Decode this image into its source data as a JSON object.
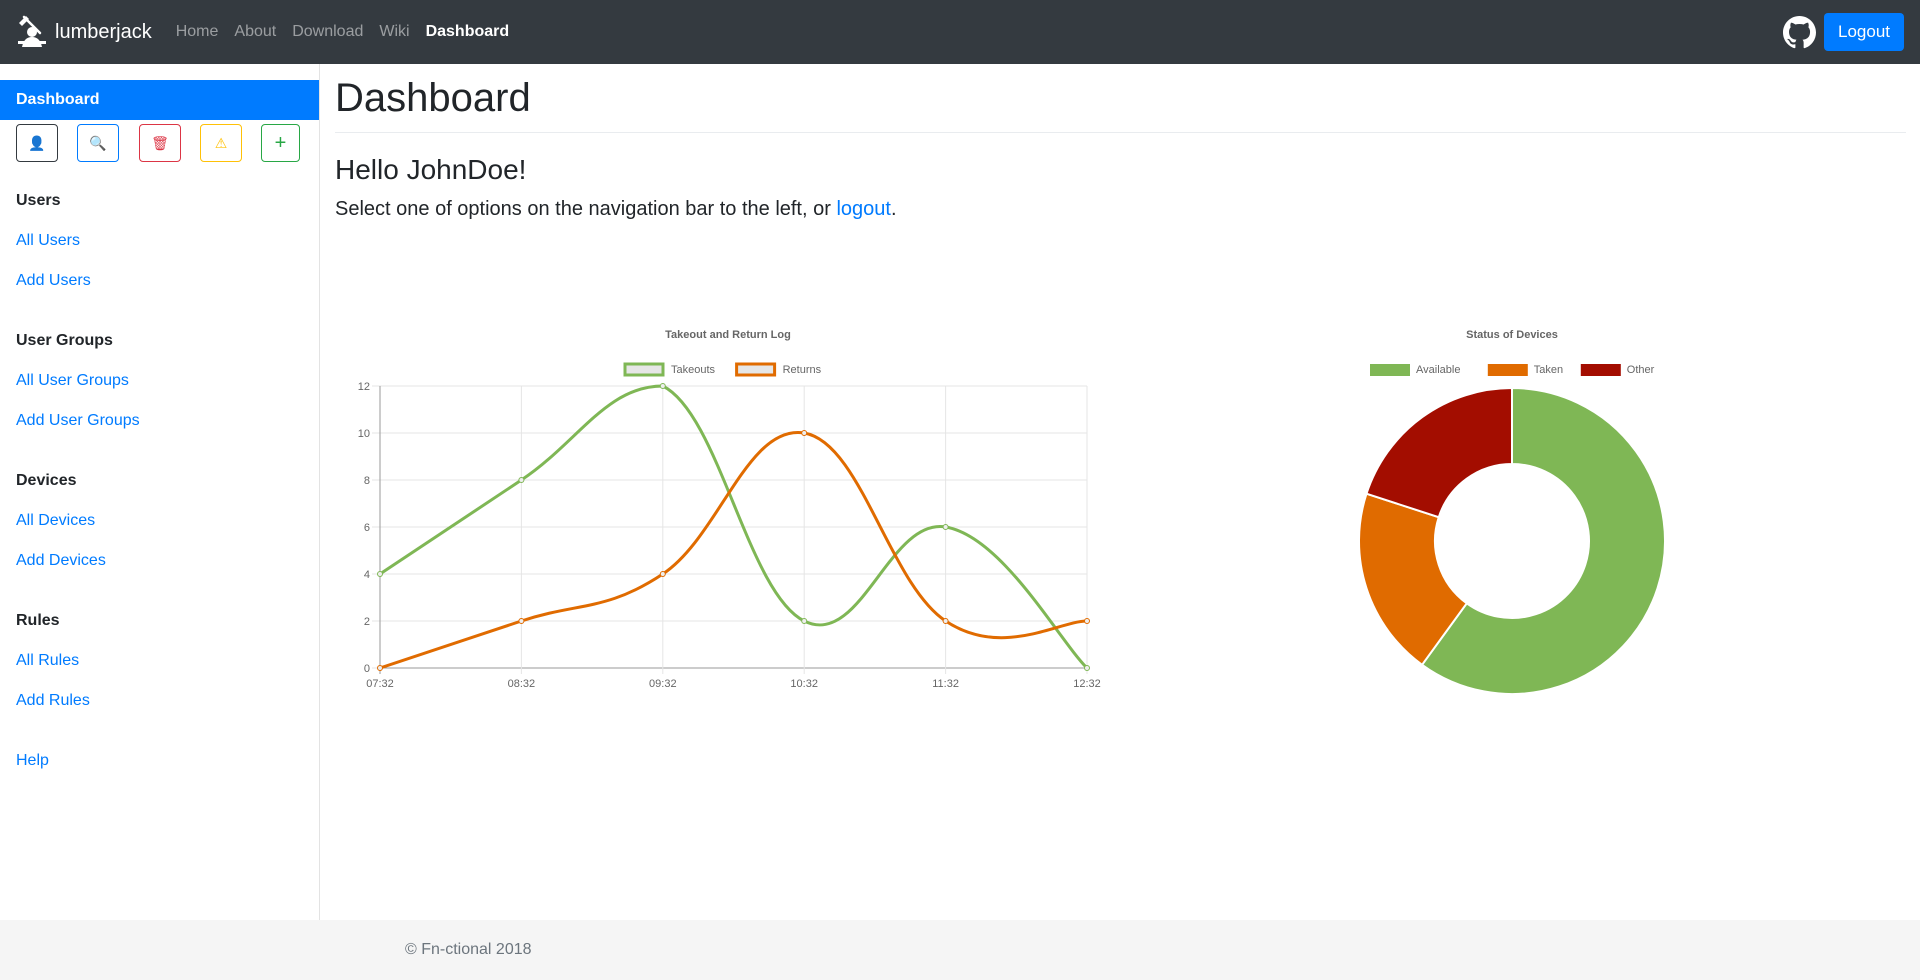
{
  "navbar": {
    "brand": "lumberjack",
    "links": [
      "Home",
      "About",
      "Download",
      "Wiki",
      "Dashboard"
    ],
    "active_link": "Dashboard",
    "logout": "Logout",
    "github_icon": "github-icon",
    "brand_icon": "lumberjack-logo-icon"
  },
  "sidebar": {
    "active_item": "Dashboard",
    "quick_actions": [
      {
        "icon": "user-icon",
        "glyph": "👤",
        "color": "#343a40"
      },
      {
        "icon": "search-icon",
        "glyph": "🔍",
        "color": "#007bff"
      },
      {
        "icon": "trash-icon",
        "glyph": "🗑",
        "color": "#dc3545"
      },
      {
        "icon": "warning-icon",
        "glyph": "⚠",
        "color": "#ffc107"
      },
      {
        "icon": "plus-icon",
        "glyph": "+",
        "color": "#28a745"
      }
    ],
    "sections": {
      "users": {
        "heading": "Users",
        "links": [
          "All Users",
          "Add Users"
        ]
      },
      "user_groups": {
        "heading": "User Groups",
        "links": [
          "All User Groups",
          "Add User Groups"
        ]
      },
      "devices": {
        "heading": "Devices",
        "links": [
          "All Devices",
          "Add Devices"
        ]
      },
      "rules": {
        "heading": "Rules",
        "links": [
          "All Rules",
          "Add Rules"
        ]
      }
    },
    "help": "Help"
  },
  "main": {
    "title": "Dashboard",
    "greeting": "Hello JohnDoe!",
    "lead_before": "Select one of options on the navigation bar to the left, or ",
    "lead_link": "logout",
    "lead_after": "."
  },
  "colors": {
    "takeouts": "#7fb755",
    "returns": "#e06b00",
    "available": "#7fb755",
    "taken": "#e06b00",
    "other": "#a30d00",
    "accent": "#007bff"
  },
  "chart_data": [
    {
      "type": "line",
      "title": "Takeout and Return Log",
      "x": [
        "07:32",
        "08:32",
        "09:32",
        "10:32",
        "11:32",
        "12:32"
      ],
      "series": [
        {
          "name": "Takeouts",
          "values": [
            4,
            8,
            12,
            2,
            6,
            0
          ]
        },
        {
          "name": "Returns",
          "values": [
            0,
            2,
            4,
            10,
            2,
            2
          ]
        }
      ],
      "ylim": [
        0,
        12
      ],
      "yticks": [
        "0",
        "2",
        "4",
        "6",
        "8",
        "10",
        "12"
      ],
      "grid": true,
      "legend": "top-center"
    },
    {
      "type": "pie",
      "variant": "doughnut",
      "title": "Status of Devices",
      "labels": [
        "Available",
        "Taken",
        "Other"
      ],
      "values": [
        60,
        20,
        20
      ],
      "legend": "top-center"
    }
  ],
  "footer": {
    "text": "© Fn-ctional 2018"
  }
}
